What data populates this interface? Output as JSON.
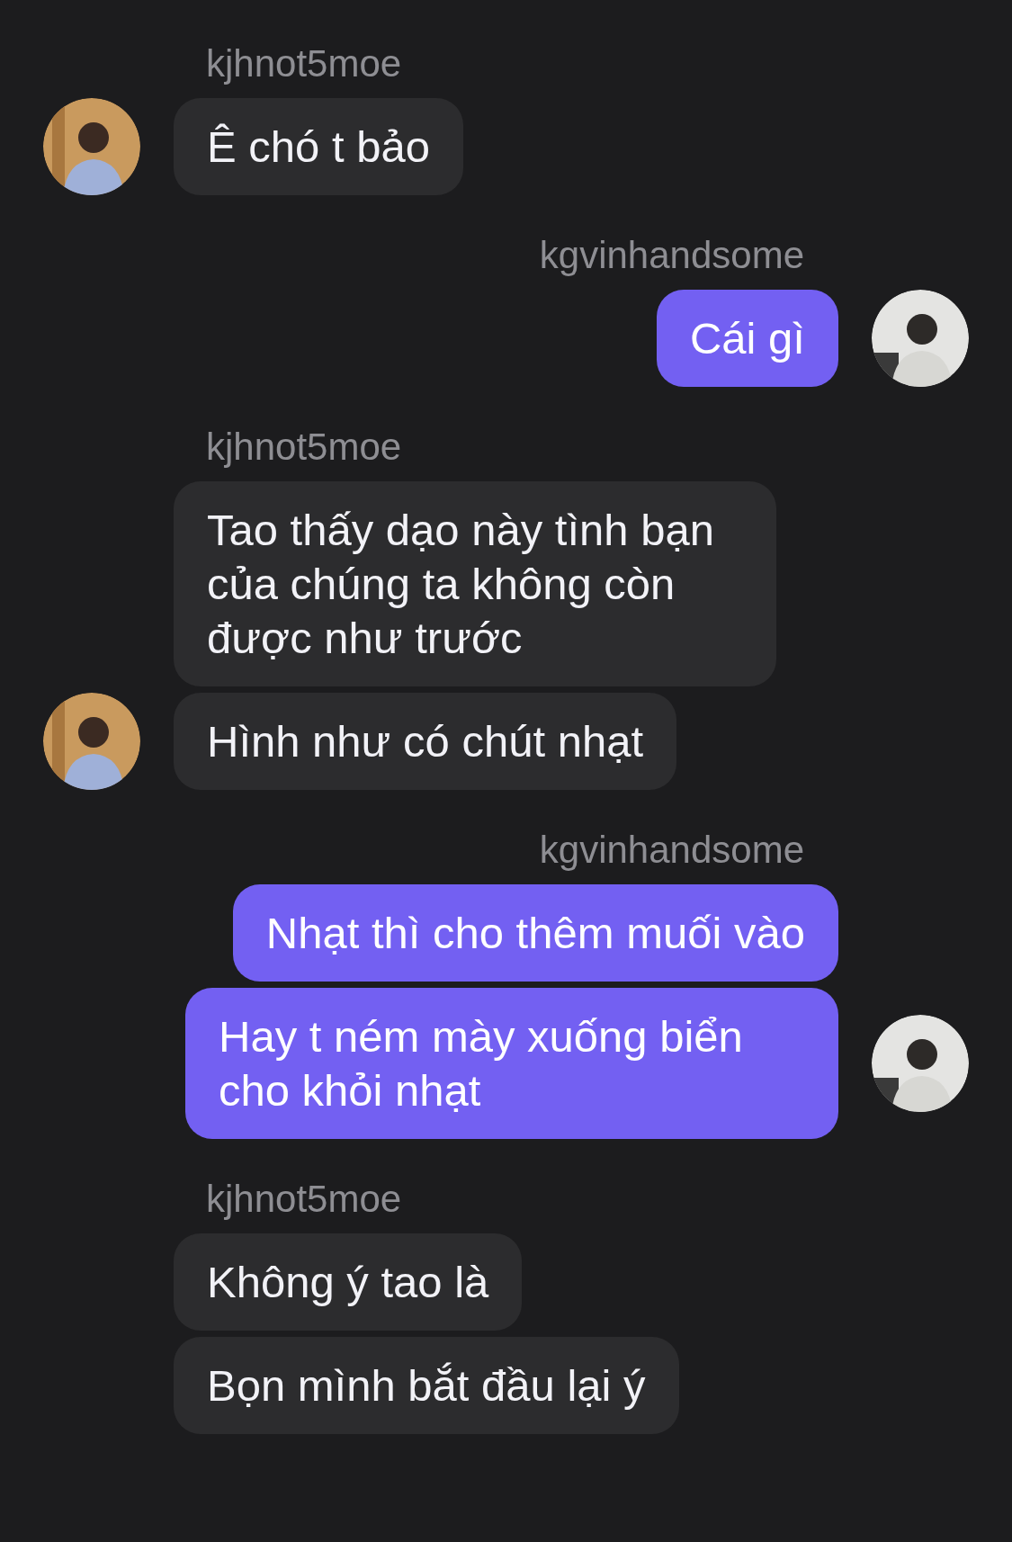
{
  "groups": [
    {
      "kind": "received",
      "sender": "kjhnot5moe",
      "avatar_shown": true,
      "messages": [
        "Ê chó t bảo"
      ]
    },
    {
      "kind": "sent",
      "sender": "kgvinhandsome",
      "avatar_shown": true,
      "messages": [
        "Cái gì"
      ]
    },
    {
      "kind": "received",
      "sender": "kjhnot5moe",
      "avatar_shown": true,
      "messages": [
        "Tao thấy dạo này tình bạn của chúng ta không còn được như trước",
        "Hình như có chút nhạt"
      ]
    },
    {
      "kind": "sent",
      "sender": "kgvinhandsome",
      "avatar_shown": true,
      "messages": [
        "Nhạt thì cho thêm muối vào",
        "Hay t ném mày xuống biển cho khỏi nhạt"
      ]
    },
    {
      "kind": "received",
      "sender": "kjhnot5moe",
      "avatar_shown": false,
      "messages": [
        "Không ý tao là",
        "Bọn mình bắt đầu lại ý"
      ]
    }
  ]
}
